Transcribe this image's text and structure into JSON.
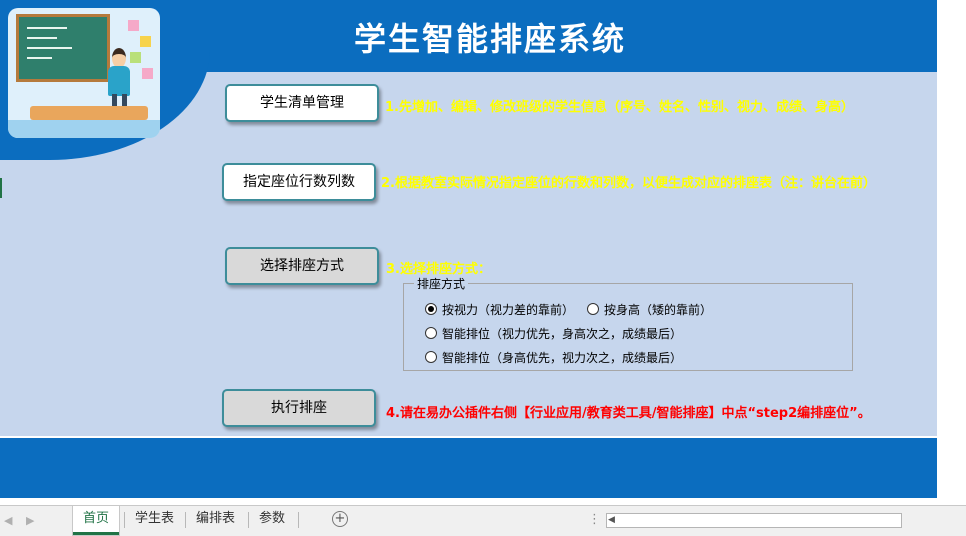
{
  "header": {
    "title": "学生智能排座系统"
  },
  "buttons": {
    "student_list": "学生清单管理",
    "seat_rows_cols": "指定座位行数列数",
    "select_mode": "选择排座方式",
    "execute": "执行排座"
  },
  "steps": {
    "step1": "1.先增加、编辑、修改班级的学生信息（序号、姓名、性别、视力、成绩、身高）",
    "step2": "2.根据教室实际情况指定座位的行数和列数，以便生成对应的排座表（注：讲台在前）",
    "step3": "3.选择排座方式：",
    "step4": "4.请在易办公插件右侧【行业应用/教育类工具/智能排座】中点“step2编排座位”。"
  },
  "seat_mode": {
    "group_title": "排座方式",
    "options": [
      {
        "label": "按视力（视力差的靠前）",
        "selected": true
      },
      {
        "label": "按身高（矮的靠前）",
        "selected": false
      },
      {
        "label": "智能排位（视力优先，身高次之，成绩最后）",
        "selected": false
      },
      {
        "label": "智能排位（身高优先，视力次之，成绩最后）",
        "selected": false
      }
    ]
  },
  "sheet_tabs": [
    {
      "label": "首页",
      "active": true
    },
    {
      "label": "学生表",
      "active": false
    },
    {
      "label": "编排表",
      "active": false
    },
    {
      "label": "参数",
      "active": false
    }
  ],
  "icons": {
    "add_sheet": "plus-circle-icon",
    "prev": "left-arrow-icon",
    "next": "right-arrow-icon"
  },
  "colors": {
    "header": "#0b6dbf",
    "panel": "#c6d6ed",
    "step_yellow": "#ffff00",
    "step_red": "#ff0000",
    "active_tab": "#217346"
  }
}
